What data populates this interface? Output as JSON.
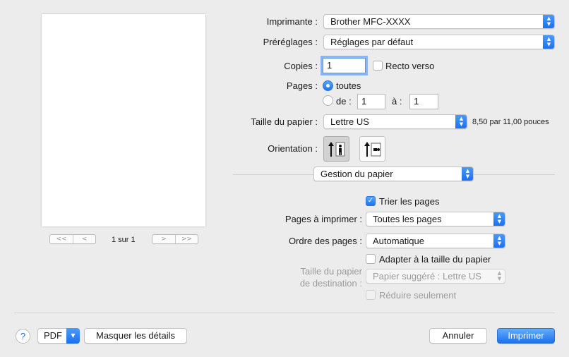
{
  "printer": {
    "label": "Imprimante :",
    "value": "Brother MFC-XXXX"
  },
  "presets": {
    "label": "Préréglages :",
    "value": "Réglages par défaut"
  },
  "copies": {
    "label": "Copies :",
    "value": "1",
    "duplex_label": "Recto verso",
    "duplex_checked": false
  },
  "pages": {
    "label": "Pages :",
    "all_label": "toutes",
    "range_from_label": "de :",
    "from_value": "1",
    "to_label": "à :",
    "to_value": "1",
    "selected": "all"
  },
  "paper_size": {
    "label": "Taille du papier :",
    "value": "Lettre US",
    "dimensions": "8,50 par 11,00 pouces"
  },
  "orientation": {
    "label": "Orientation :",
    "selected": "portrait",
    "options": [
      "portrait-icon",
      "landscape-icon"
    ]
  },
  "section_popup": {
    "value": "Gestion du papier"
  },
  "paper_handling": {
    "collate_label": "Trier les pages",
    "collate_checked": true,
    "pages_to_print_label": "Pages à imprimer :",
    "pages_to_print_value": "Toutes les pages",
    "page_order_label": "Ordre des pages :",
    "page_order_value": "Automatique",
    "scale_to_fit_label": "Adapter à la taille du papier",
    "scale_to_fit_checked": false,
    "dest_paper_label_line1": "Taille du papier",
    "dest_paper_label_line2": "de destination :",
    "dest_paper_value": "Papier suggéré : Lettre US",
    "scale_down_only_label": "Réduire seulement",
    "scale_down_only_checked": false
  },
  "preview": {
    "page_count": "1 sur 1",
    "nav": [
      "<<",
      "<",
      ">",
      ">>"
    ]
  },
  "footer": {
    "help_label": "?",
    "pdf_label": "PDF",
    "hide_details_label": "Masquer les détails",
    "cancel_label": "Annuler",
    "print_label": "Imprimer"
  },
  "colors": {
    "accent": "#1c72f0",
    "background": "#ececec"
  }
}
